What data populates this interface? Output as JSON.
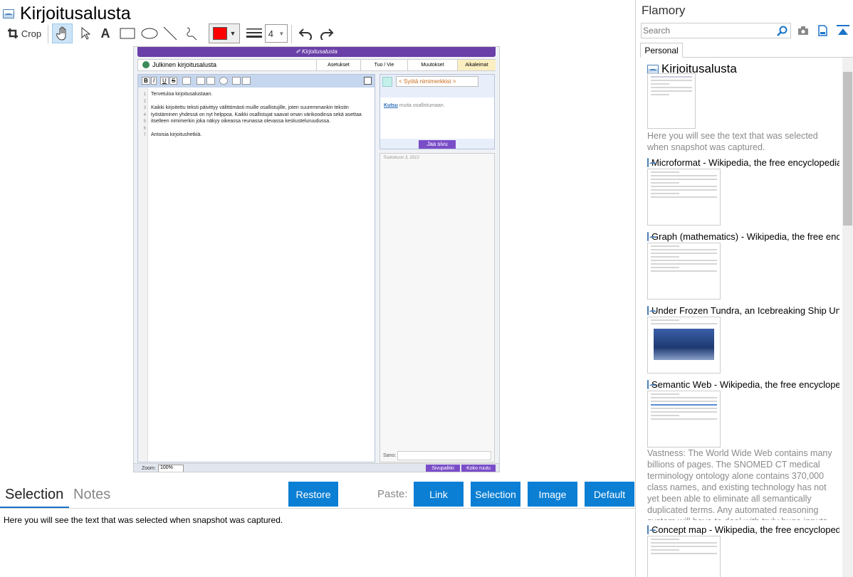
{
  "window": {
    "title": "Kirjoitusalusta"
  },
  "toolbar": {
    "crop_label": "Crop",
    "line_width_value": "4",
    "pen_color": "#ff0000"
  },
  "screenshot": {
    "header": "✐ Kirjoitusalusta",
    "pad_name": "Julkinen kirjoitusalusta",
    "tabs": [
      "Asetukset",
      "Tuo / Vie",
      "Muutokset",
      "Aikaleimat"
    ],
    "editor_lines": [
      "Tervetuloa kirjoitusalustaan.",
      "",
      "Kaikki kirjoitettu teksti päivittyy välittömästi muille osallistujille, joten suuremmankin tekstin työstäminen yhdessä on nyt helppoa. Kaikki osallistujat saavat oman värikoodinsa sekä asettaa itselleen nimimerkin joka näkyy oikeassa reunassa olevassa keskusteluruudussa.",
      "",
      "Antoisia kirjoitushetkiä."
    ],
    "line_numbers": [
      "1",
      "2",
      "3",
      "4",
      "5",
      "6",
      "7"
    ],
    "nick_placeholder": "< Syötä nimimerkkisi >",
    "invite_link": "Kutsu",
    "invite_text": " muita osallistumaan.",
    "share_button": "Jaa sivu",
    "chat_date": "Toukokuun 3, 2012",
    "say_label": "Sano:",
    "zoom_label": "Zoom:",
    "zoom_value": "100%",
    "btn_sidebar": "Sivupalkki",
    "btn_fullscreen": "Koko ruutu"
  },
  "bottom": {
    "tabs": [
      "Selection",
      "Notes"
    ],
    "restore": "Restore",
    "paste_label": "Paste:",
    "paste_buttons": [
      "Link",
      "Selection",
      "Image",
      "Default"
    ],
    "selection_text": "Here you will see the text that was selected when snapshot was captured."
  },
  "sidebar": {
    "app_name": "Flamory",
    "search_placeholder": "Search",
    "tab": "Personal",
    "items": [
      {
        "title": "Kirjoitusalusta",
        "desc": "Here you will see the text that was selected when snapshot was captured."
      },
      {
        "title": "Microformat - Wikipedia, the free encyclopedia"
      },
      {
        "title": "Graph (mathematics) - Wikipedia, the free ency"
      },
      {
        "title": "Under Frozen Tundra, an Icebreaking Ship Unco"
      },
      {
        "title": "Semantic Web - Wikipedia, the free encycloped",
        "desc": "Vastness: The World Wide Web contains many billions of pages. The SNOMED CT medical terminology ontology alone contains 370,000 class names, and existing technology has not yet been able to eliminate all semantically duplicated terms. Any automated reasoning system will have to deal with truly huge inputs."
      },
      {
        "title": "Concept map - Wikipedia, the free encyclopedi"
      }
    ]
  }
}
